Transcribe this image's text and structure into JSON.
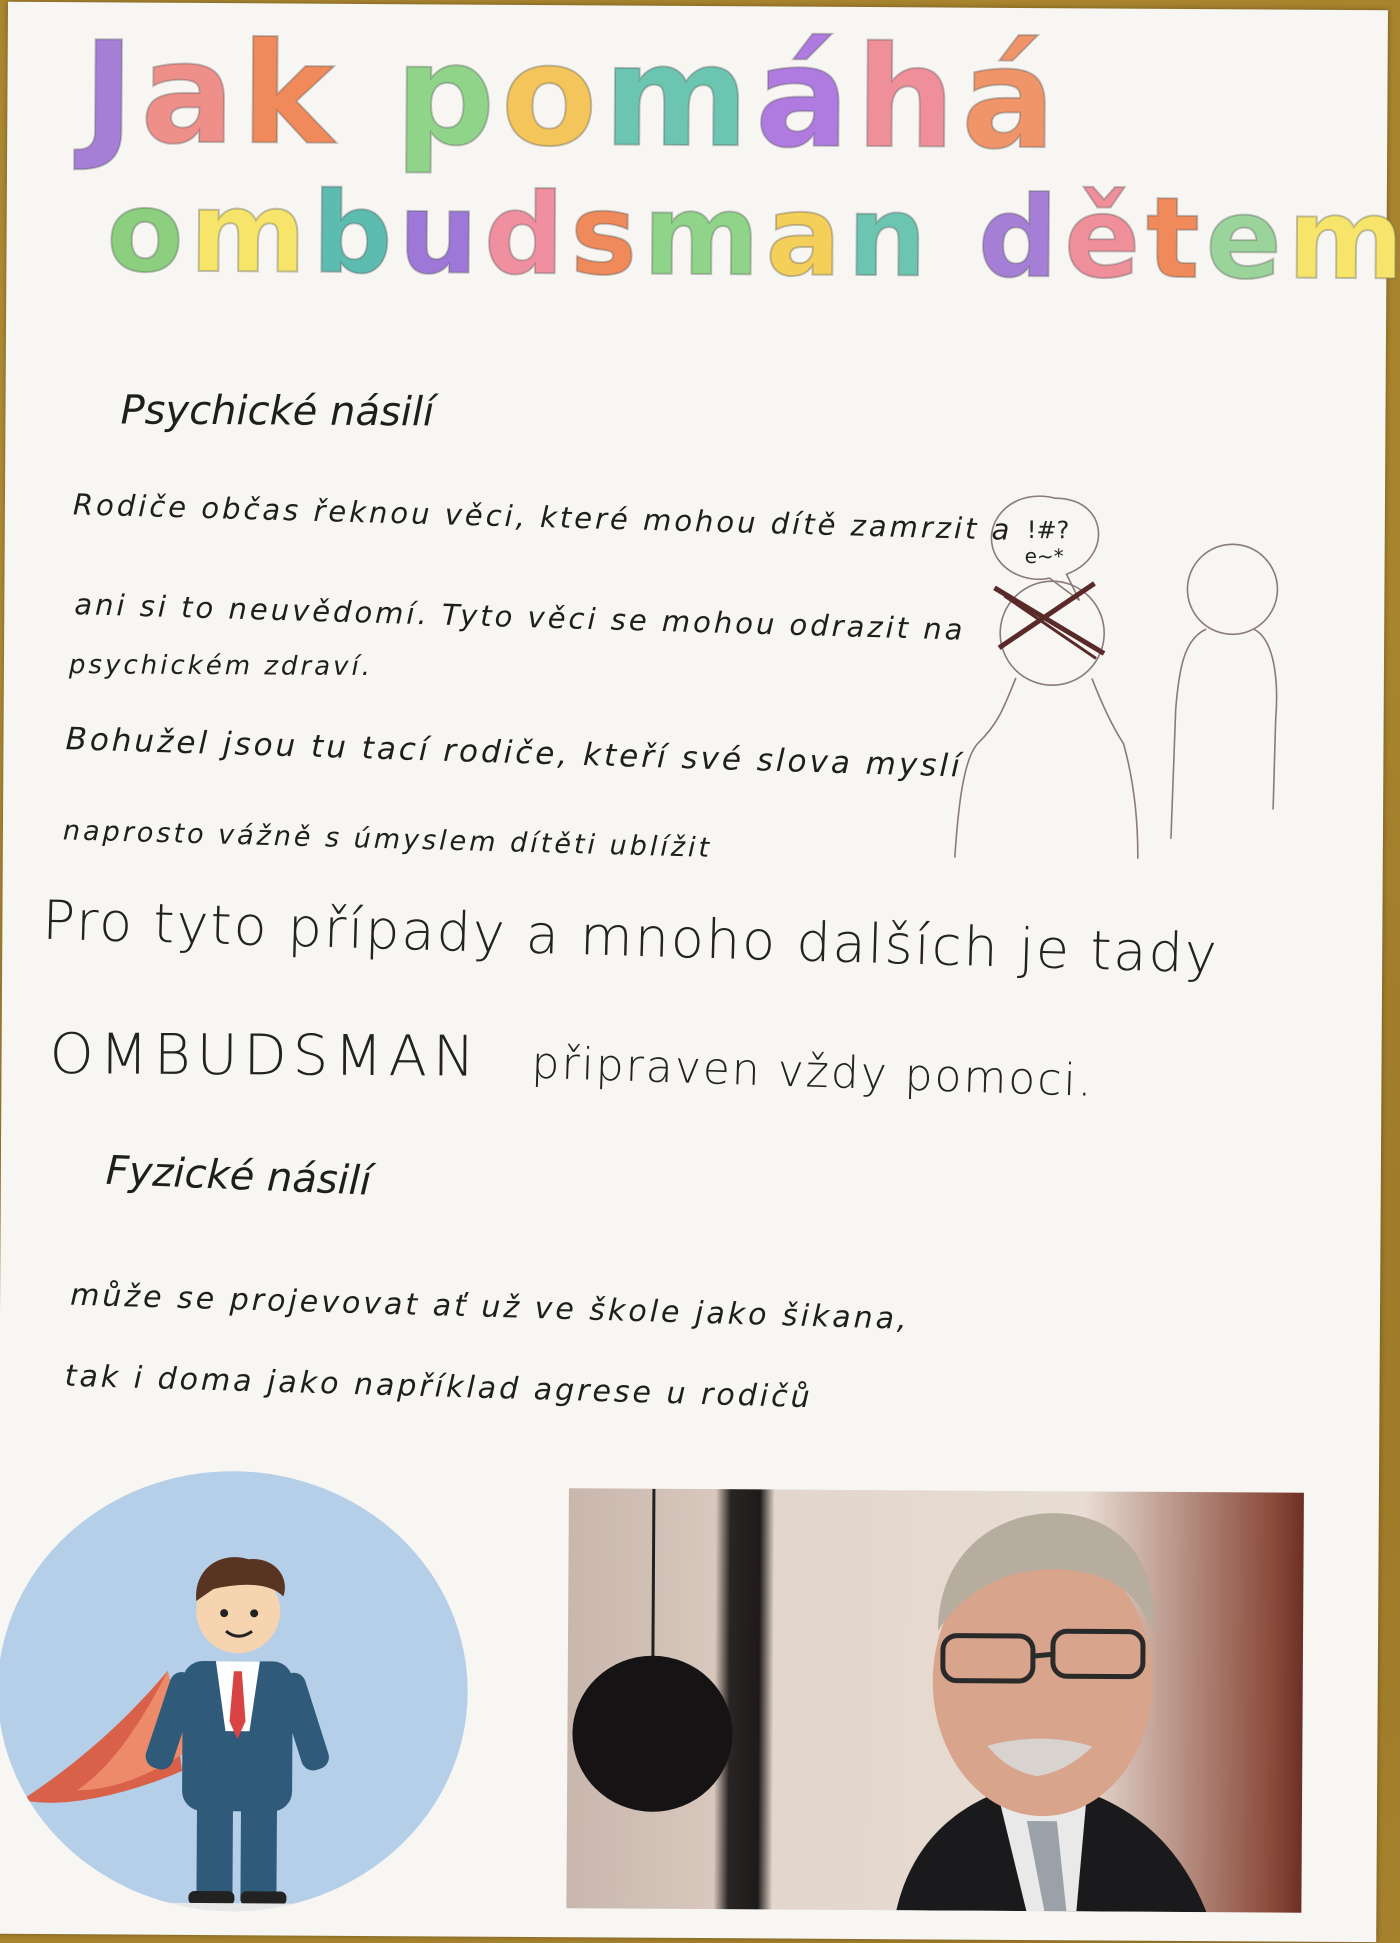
{
  "poster": {
    "title_line1": [
      "J",
      "a",
      "k",
      " ",
      "p",
      "o",
      "m",
      "á",
      "h",
      "á"
    ],
    "title_line2": [
      "o",
      "m",
      "b",
      "u",
      "d",
      "s",
      "m",
      "a",
      "n",
      " ",
      "d",
      "ě",
      "t",
      "e",
      "m"
    ],
    "title_colors_line1": [
      "#a57fd6",
      "#ef8f8a",
      "#f08a5a",
      "",
      "#8fd489",
      "#f4c55a",
      "#6cc5b0",
      "#b07be0",
      "#ef8f9a",
      "#f0956a"
    ],
    "title_colors_line2": [
      "#8ccf7e",
      "#f6e56a",
      "#5dbcb0",
      "#9d78d8",
      "#ef8fa0",
      "#f08a5a",
      "#8fd489",
      "#f4cf5a",
      "#6cc5b0",
      "",
      "#a57fd6",
      "#ef8f9a",
      "#f08a5a",
      "#9ad49a",
      "#f6e56a"
    ],
    "section1_heading": "Psychické násilí",
    "section1_p1_line1": "Rodiče občas řeknou věci, které mohou dítě zamrzit a",
    "section1_p1_line2": "ani si to neuvědomí. Tyto věci se mohou odrazit na",
    "section1_p1_line3": "psychickém zdraví.",
    "section1_p2_line1": "Bohužel jsou tu tací rodiče, kteří své slova myslí",
    "section1_p2_line2": "naprosto vážně s úmyslem dítěti ublížit",
    "callout_line1": "Pro tyto případy a mnoho dalších je tady",
    "callout_line2_a": "OMBUDSMAN",
    "callout_line2_b": "připraven vždy pomoci.",
    "section2_heading": "Fyzické násilí",
    "section2_line1": "může se projevovat ať už ve škole jako šikana,",
    "section2_line2": "tak i doma jako například agrese u rodičů",
    "speech_bubble_text": "!#?",
    "speech_bubble_text2": "e~*"
  }
}
